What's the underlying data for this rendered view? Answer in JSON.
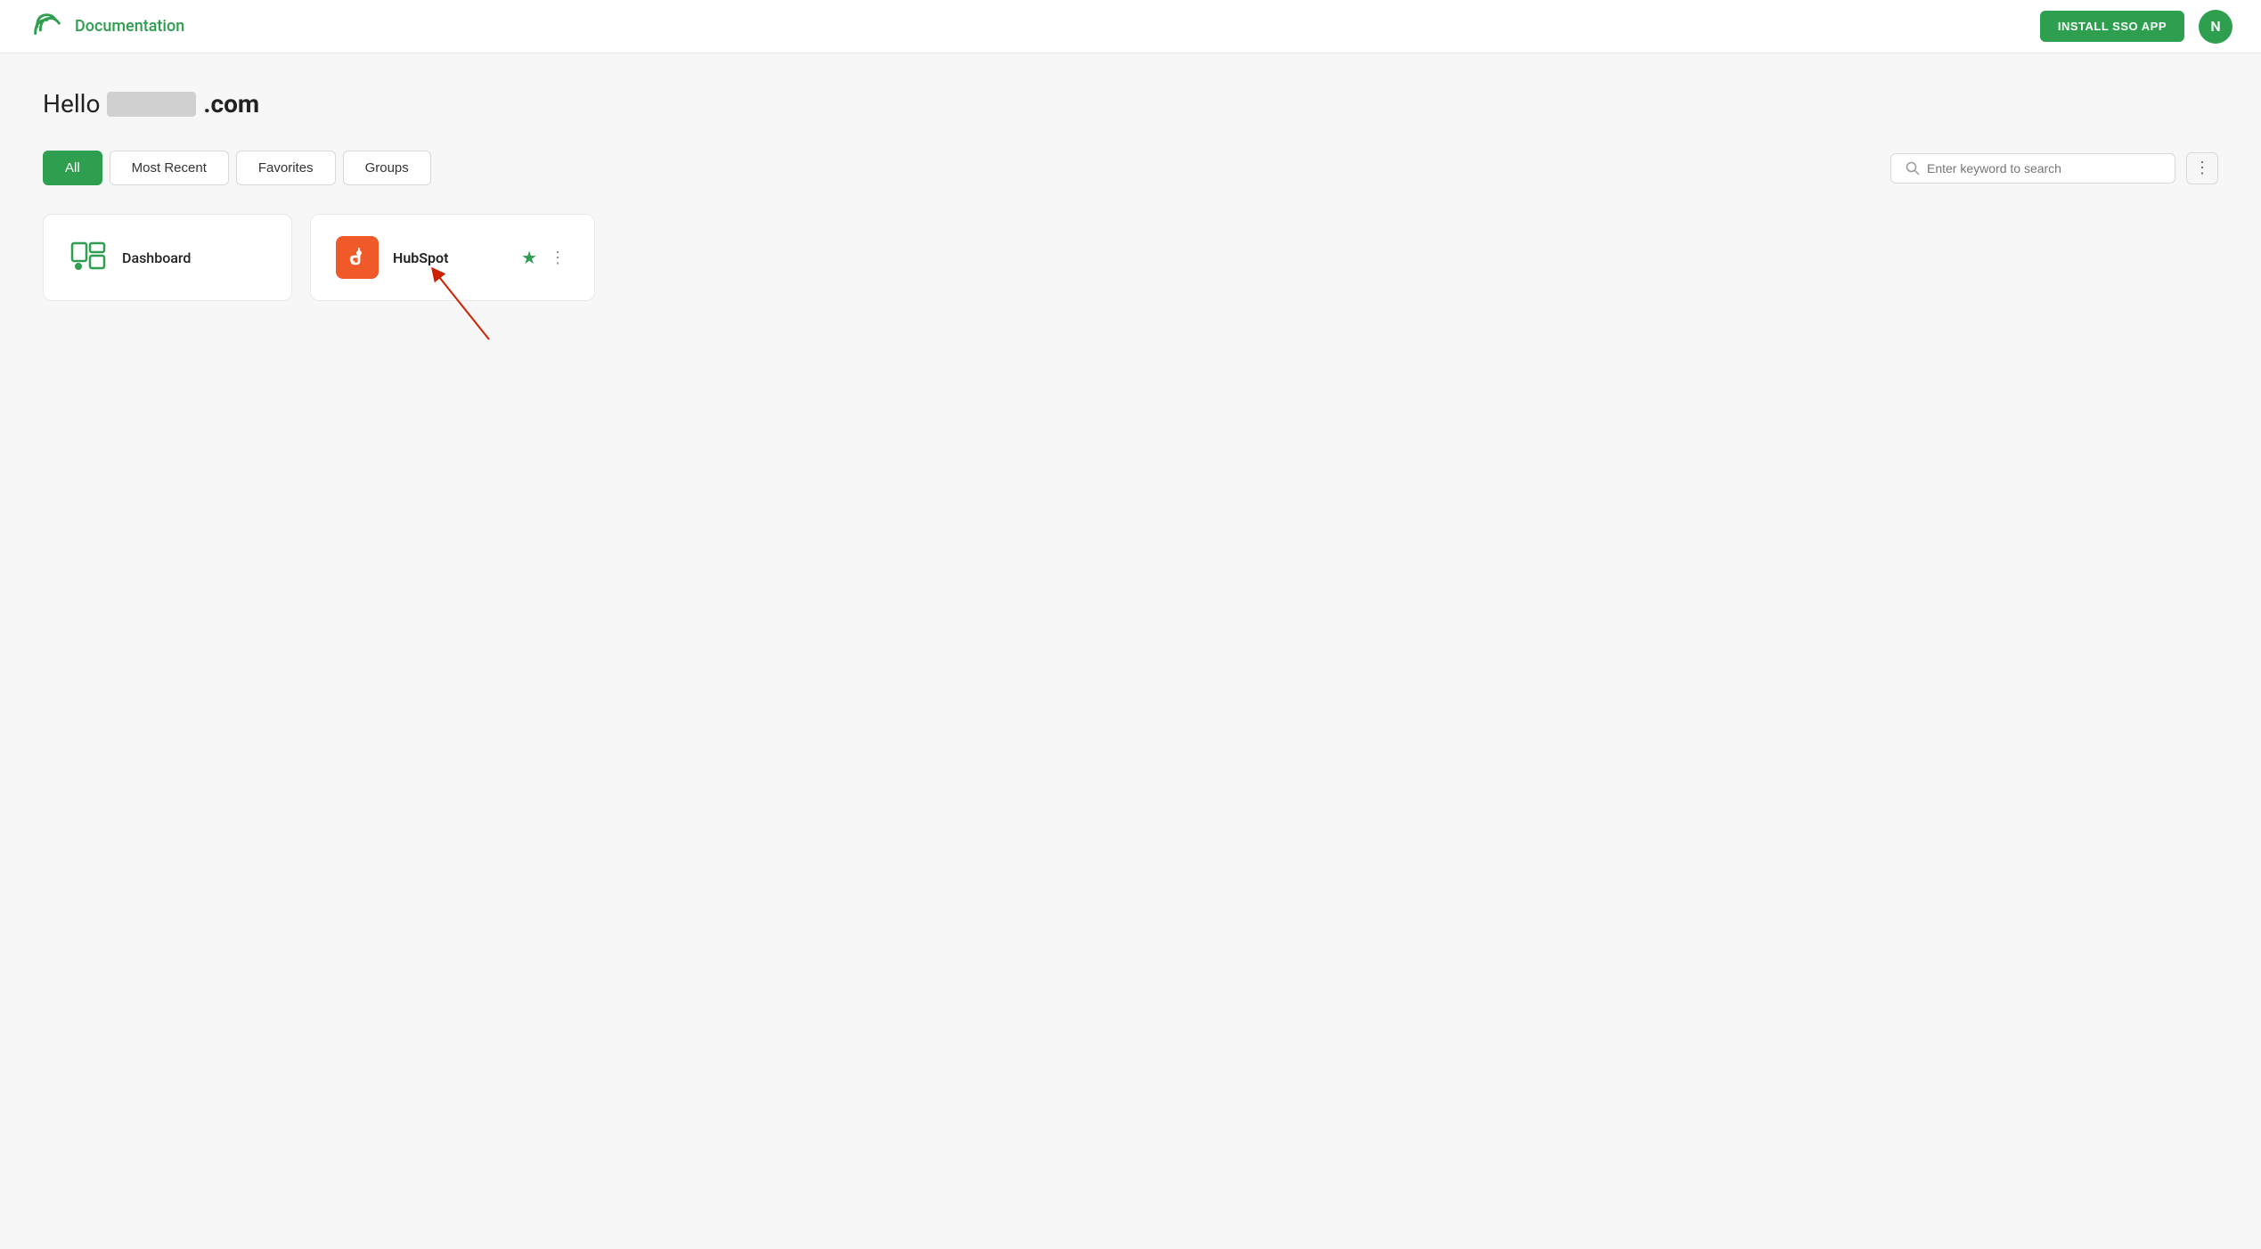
{
  "header": {
    "logo_alt": "Logo",
    "title": "Documentation",
    "install_sso_label": "INSTALL SSO APP",
    "avatar_initial": "N"
  },
  "greeting": {
    "hello": "Hello",
    "name_placeholder": "",
    "domain": ".com"
  },
  "tabs": [
    {
      "id": "all",
      "label": "All",
      "active": true
    },
    {
      "id": "most-recent",
      "label": "Most Recent",
      "active": false
    },
    {
      "id": "favorites",
      "label": "Favorites",
      "active": false
    },
    {
      "id": "groups",
      "label": "Groups",
      "active": false
    }
  ],
  "search": {
    "placeholder": "Enter keyword to search"
  },
  "cards": [
    {
      "id": "dashboard",
      "label": "Dashboard",
      "type": "dashboard"
    },
    {
      "id": "hubspot",
      "label": "HubSpot",
      "type": "hubspot",
      "favorited": true
    }
  ],
  "icons": {
    "search": "🔍",
    "star_filled": "★",
    "kebab": "⋮",
    "more_options": "⋮"
  }
}
